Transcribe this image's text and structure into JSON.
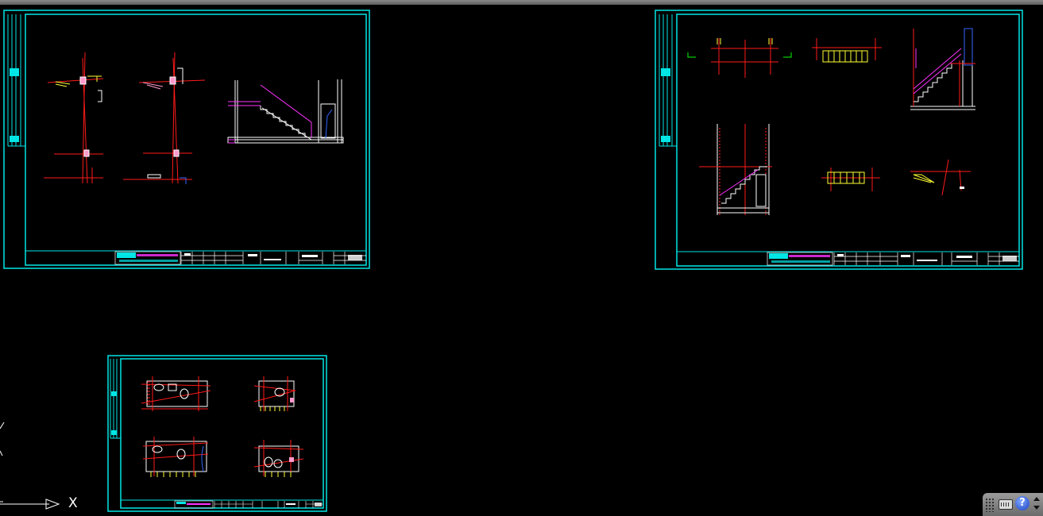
{
  "ucs": {
    "x_axis_label": "X"
  },
  "statusbar": {
    "keyboard_icon": "keyboard-icon",
    "help_icon": "help-icon",
    "help_glyph": "?",
    "menu_icon": "up-down-arrow-icon"
  },
  "colors": {
    "background": "#000000",
    "sheet_border": "#00e5e5",
    "red_lines": "#ff1a1a",
    "magenta_lines": "#ff33ff",
    "yellow_lines": "#ffff33",
    "white_lines": "#ffffff",
    "green_marks": "#00ff00",
    "blue_lines": "#3366ff"
  }
}
